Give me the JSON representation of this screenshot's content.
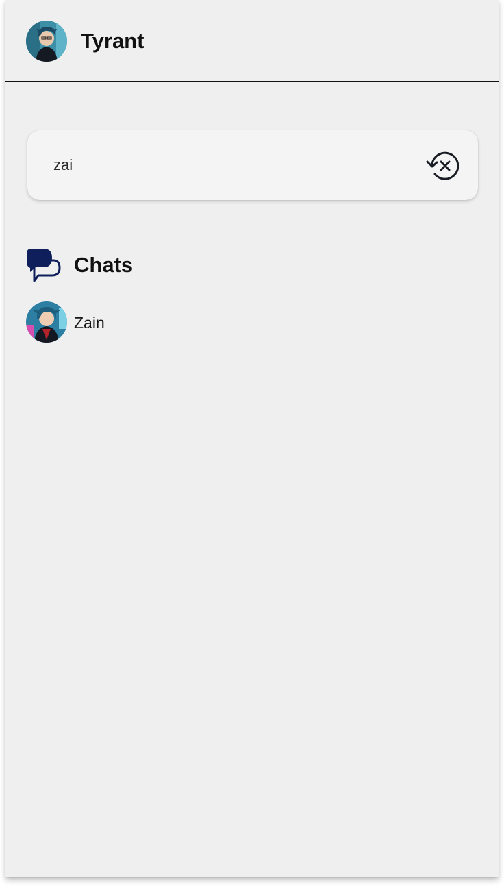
{
  "header": {
    "title": "Tyrant",
    "avatar_icon": "user-avatar"
  },
  "search": {
    "value": "zai",
    "placeholder": "",
    "clear_icon": "clear-history-icon"
  },
  "chats_section": {
    "title": "Chats",
    "icon": "chat-bubbles-icon",
    "icon_color": "#0f1f5c",
    "items": [
      {
        "name": "Zain",
        "avatar_icon": "contact-avatar"
      }
    ]
  },
  "colors": {
    "background": "#efeff0",
    "search_box": "#f4f4f4",
    "text": "#111111"
  }
}
